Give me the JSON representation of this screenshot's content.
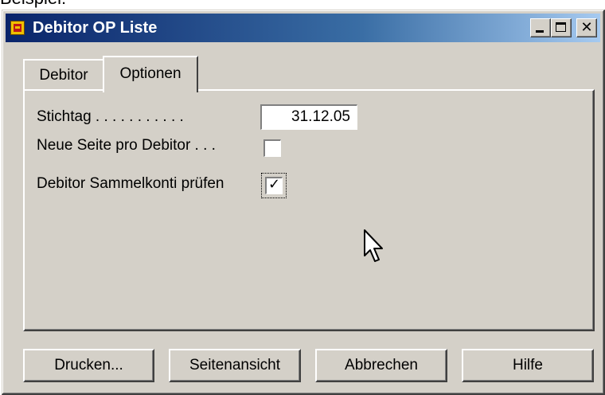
{
  "caption": "Beispiel:",
  "window": {
    "title": "Debitor OP Liste",
    "controls": {
      "minimize": "_",
      "maximize": "□",
      "close": "✕"
    }
  },
  "tabs": [
    {
      "label": "Debitor",
      "active": false
    },
    {
      "label": "Optionen",
      "active": true
    }
  ],
  "options": {
    "stichtag_label": "Stichtag . . . . . . . . . . .",
    "stichtag_value": "31.12.05",
    "neue_seite_label": "Neue Seite pro Debitor . . .",
    "neue_seite_checked": false,
    "sammelkonti_label": "Debitor Sammelkonti prüfen",
    "sammelkonti_checked": true,
    "check_mark": "✓"
  },
  "buttons": {
    "drucken": "Drucken...",
    "seitenansicht": "Seitenansicht",
    "abbrechen": "Abbrechen",
    "hilfe": "Hilfe"
  },
  "icons": {
    "app": "navision-report-icon",
    "cursor": "mouse-pointer-icon"
  }
}
